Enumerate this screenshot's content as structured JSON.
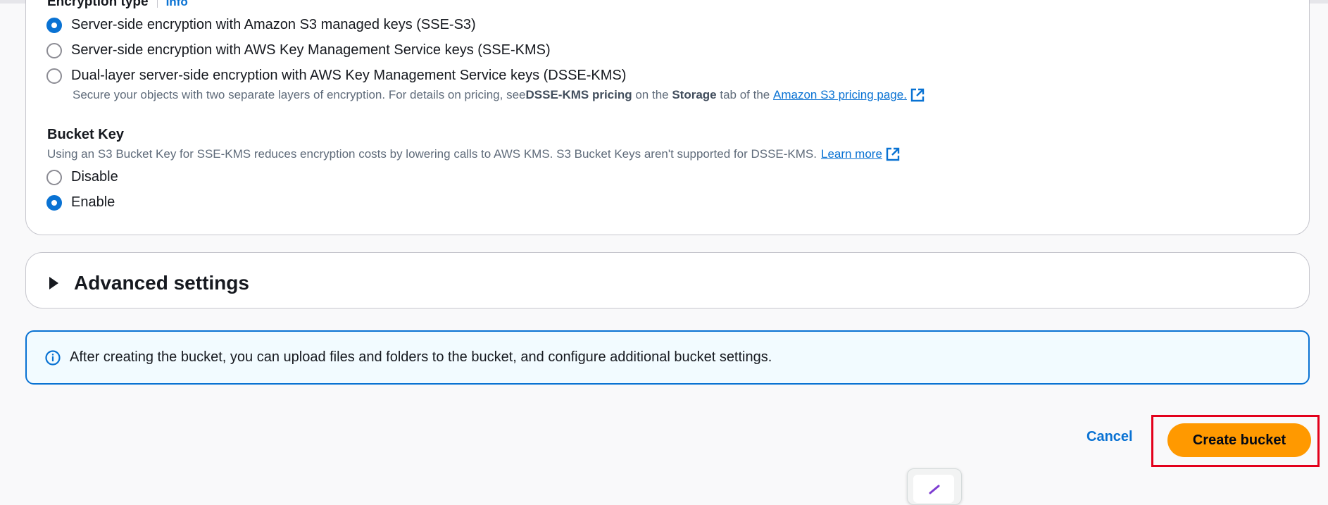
{
  "encryption": {
    "heading": "Encryption type",
    "info_link": "Info",
    "options": [
      {
        "label": "Server-side encryption with Amazon S3 managed keys (SSE-S3)",
        "checked": true
      },
      {
        "label": "Server-side encryption with AWS Key Management Service keys (SSE-KMS)",
        "checked": false
      },
      {
        "label": "Dual-layer server-side encryption with AWS Key Management Service keys (DSSE-KMS)",
        "checked": false
      }
    ],
    "dsse_desc": {
      "pre": "Secure your objects with two separate layers of encryption. For details on pricing, see ",
      "bold1": "DSSE-KMS pricing",
      "mid": " on the ",
      "bold2": "Storage",
      "post": " tab of the ",
      "link": "Amazon S3 pricing page."
    }
  },
  "bucket_key": {
    "title": "Bucket Key",
    "description": "Using an S3 Bucket Key for SSE-KMS reduces encryption costs by lowering calls to AWS KMS. S3 Bucket Keys aren't supported for DSSE-KMS.",
    "learn_more": "Learn more",
    "options": [
      {
        "label": "Disable",
        "checked": false
      },
      {
        "label": "Enable",
        "checked": true
      }
    ]
  },
  "advanced": {
    "title": "Advanced settings"
  },
  "info_alert": {
    "text": "After creating the bucket, you can upload files and folders to the bucket, and configure additional bucket settings."
  },
  "actions": {
    "cancel": "Cancel",
    "create": "Create bucket"
  },
  "colors": {
    "accent": "#0972d3",
    "primary_button": "#ff9900",
    "highlight": "#e3001b"
  }
}
